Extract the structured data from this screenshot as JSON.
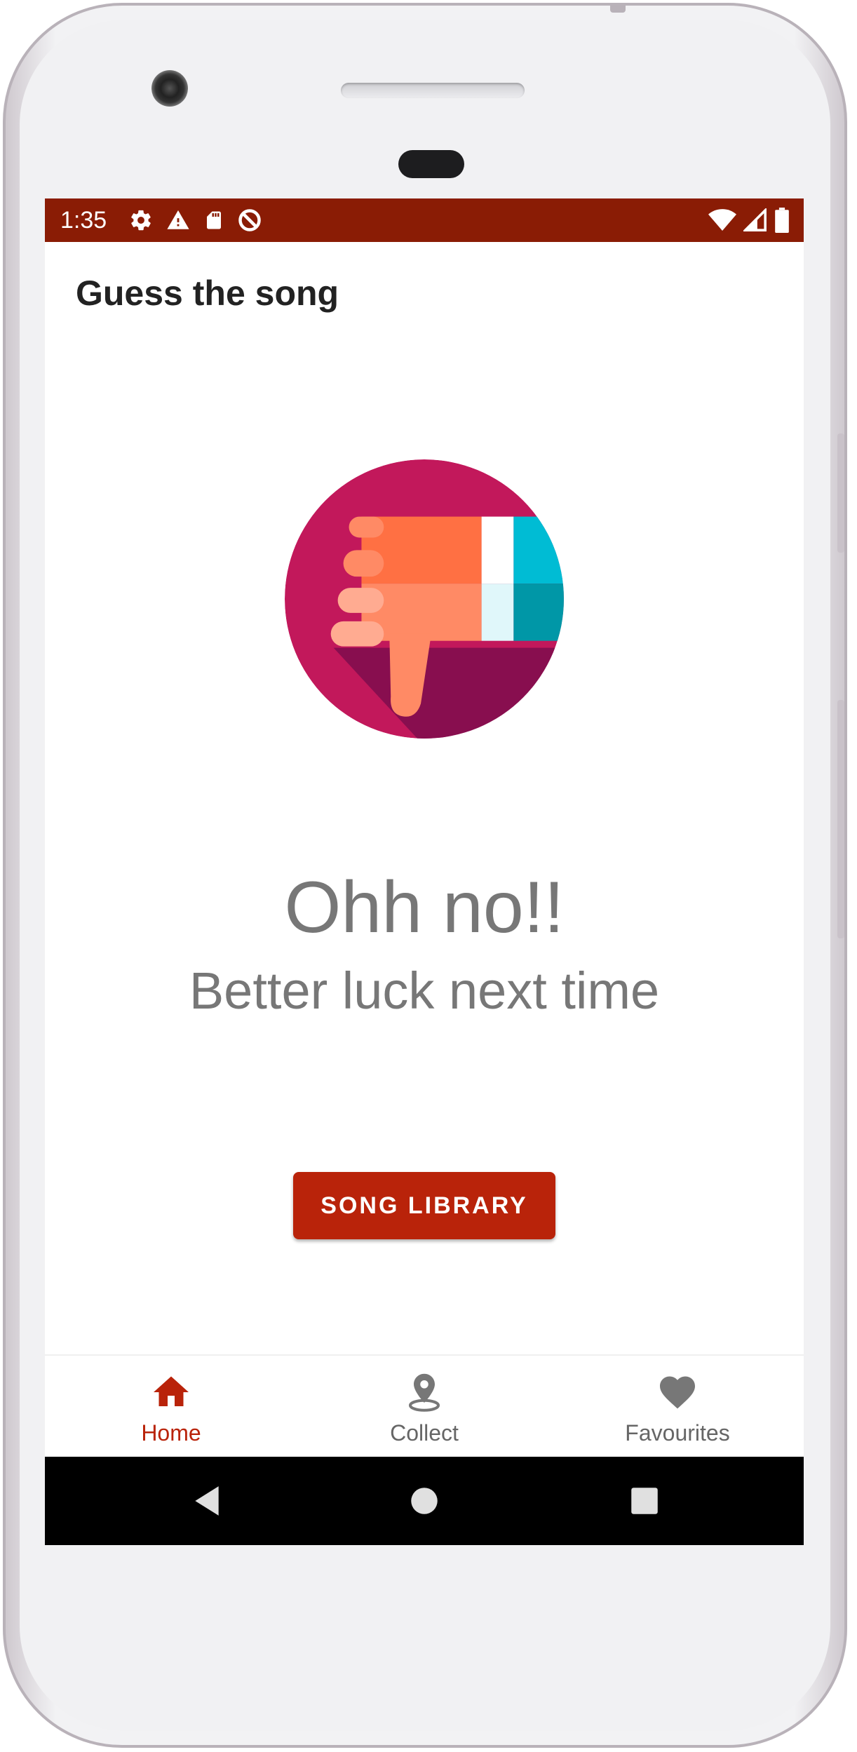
{
  "status_bar": {
    "time": "1:35",
    "background": "#8a1c05"
  },
  "app_bar": {
    "title": "Guess the song"
  },
  "result": {
    "icon": "thumbs-down-icon",
    "title": "Ohh no!!",
    "subtitle": "Better luck next time"
  },
  "actions": {
    "song_library_label": "SONG LIBRARY",
    "accent": "#b9230a"
  },
  "bottom_nav": {
    "items": [
      {
        "label": "Home",
        "icon": "home-icon",
        "active": true
      },
      {
        "label": "Collect",
        "icon": "location-pin-icon",
        "active": false
      },
      {
        "label": "Favourites",
        "icon": "heart-icon",
        "active": false
      }
    ]
  },
  "system_nav": {
    "buttons": [
      "back-icon",
      "home-circle-icon",
      "recents-icon"
    ]
  }
}
